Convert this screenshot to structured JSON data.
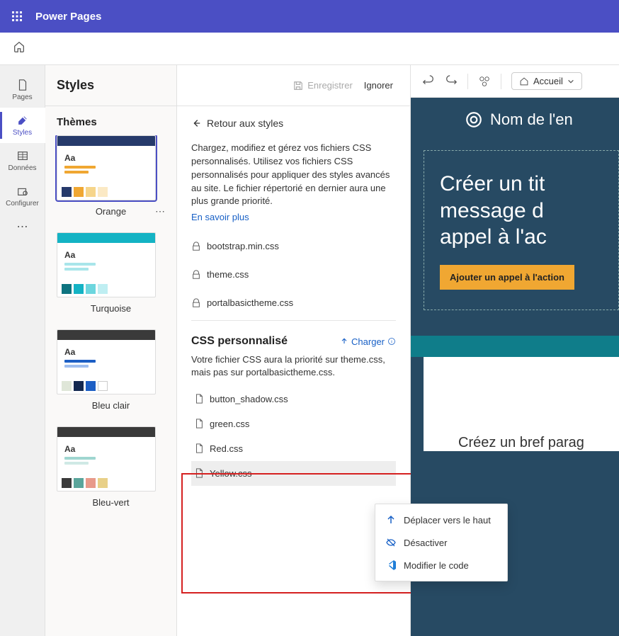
{
  "topbar": {
    "product": "Power Pages"
  },
  "rail": {
    "pages": "Pages",
    "styles": "Styles",
    "data": "Données",
    "configure": "Configurer"
  },
  "styles_panel": {
    "title": "Styles",
    "themes_label": "Thèmes",
    "themes": [
      {
        "name": "Orange"
      },
      {
        "name": "Turquoise"
      },
      {
        "name": "Bleu clair"
      },
      {
        "name": "Bleu-vert"
      }
    ]
  },
  "detail": {
    "save": "Enregistrer",
    "ignore": "Ignorer",
    "back": "Retour aux styles",
    "description": "Chargez, modifiez et gérez vos fichiers CSS personnalisés. Utilisez vos fichiers CSS personnalisés pour appliquer des styles avancés au site. Le fichier répertorié en dernier aura une plus grande priorité.",
    "learn_more": "En savoir plus",
    "base_files": [
      "bootstrap.min.css",
      "theme.css",
      "portalbasictheme.css"
    ],
    "custom_title": "CSS personnalisé",
    "upload": "Charger",
    "custom_desc": "Votre fichier CSS aura la priorité sur theme.css, mais pas sur portalbasictheme.css.",
    "custom_files": [
      "button_shadow.css",
      "green.css",
      "Red.css",
      "Yellow.css"
    ]
  },
  "context_menu": {
    "move_up": "Déplacer vers le haut",
    "disable": "Désactiver",
    "edit_code": "Modifier le code"
  },
  "preview": {
    "accueil": "Accueil",
    "site_name": "Nom de l'en",
    "hero_line1": "Créer un tit",
    "hero_line2": "message d",
    "hero_line3": "appel à l'ac",
    "cta": "Ajouter un appel à l'action",
    "bottom": "Créez un bref parag"
  }
}
